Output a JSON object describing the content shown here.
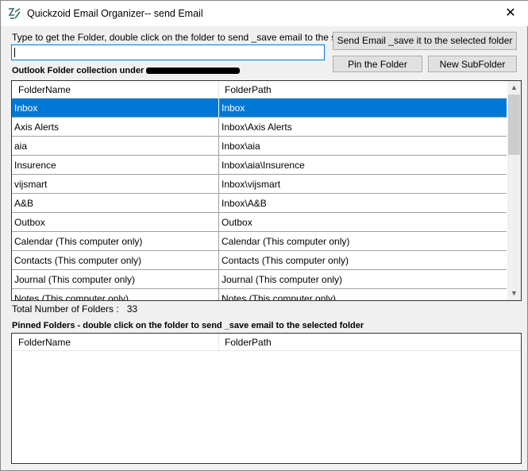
{
  "window": {
    "title": "Quickzoid Email Organizer-- send Email",
    "close_icon": "✕"
  },
  "search": {
    "label": "Type to get the Folder, double click on the folder to send _save email to the selected folder",
    "value": ""
  },
  "buttons": {
    "send_save": "Send Email _save it to the selected folder",
    "pin": "Pin the Folder",
    "new_subfolder": "New SubFolder"
  },
  "folders": {
    "label": "Outlook Folder collection under",
    "columns": [
      "FolderName",
      "FolderPath"
    ],
    "rows": [
      {
        "name": "Inbox",
        "path": "Inbox"
      },
      {
        "name": "Axis Alerts",
        "path": "Inbox\\Axis Alerts"
      },
      {
        "name": "aia",
        "path": "Inbox\\aia"
      },
      {
        "name": "Insurence",
        "path": "Inbox\\aia\\Insurence"
      },
      {
        "name": "vijsmart",
        "path": "Inbox\\vijsmart"
      },
      {
        "name": "A&B",
        "path": "Inbox\\A&B"
      },
      {
        "name": "Outbox",
        "path": "Outbox"
      },
      {
        "name": "Calendar (This computer only)",
        "path": "Calendar (This computer only)"
      },
      {
        "name": "Contacts (This computer only)",
        "path": "Contacts (This computer only)"
      },
      {
        "name": "Journal (This computer only)",
        "path": "Journal (This computer only)"
      },
      {
        "name": "Notes (This computer only)",
        "path": "Notes (This computer only)"
      }
    ],
    "total_label": "Total Number of Folders :",
    "total": "33"
  },
  "pinned": {
    "label": "Pinned Folders - double click on the folder to send _save email to the selected folder",
    "columns": [
      "FolderName",
      "FolderPath"
    ]
  },
  "colors": {
    "selection": "#0078d7"
  }
}
